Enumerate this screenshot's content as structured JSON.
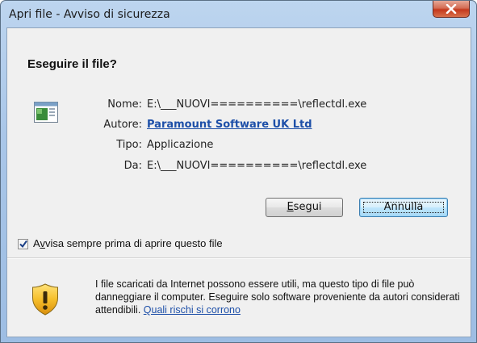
{
  "window": {
    "title": "Apri file - Avviso di sicurezza"
  },
  "dialog": {
    "heading": "Eseguire il file?",
    "fields": {
      "name_label": "Nome:",
      "name_value": "E:\\___NUOVI==========\\reflectdl.exe",
      "author_label": "Autore:",
      "author_value": "Paramount Software UK Ltd",
      "type_label": "Tipo:",
      "type_value": "Applicazione",
      "from_label": "Da:",
      "from_value": "E:\\___NUOVI==========\\reflectdl.exe"
    },
    "buttons": {
      "run_first": "E",
      "run_rest": "segui",
      "cancel": "Annulla"
    },
    "checkbox": {
      "checked": true,
      "label_before": "A",
      "label_mnemonic": "v",
      "label_after": "visa sempre prima di aprire questo file"
    },
    "warning": {
      "text": "I file scaricati da Internet possono essere utili, ma questo tipo di file può danneggiare il computer. Eseguire solo software proveniente da autori considerati attendibili.",
      "link": "Quali rischi si corrono"
    }
  },
  "colors": {
    "link": "#1d4fa8",
    "close_button": "#c4381c",
    "shield": "#f2b21b"
  }
}
